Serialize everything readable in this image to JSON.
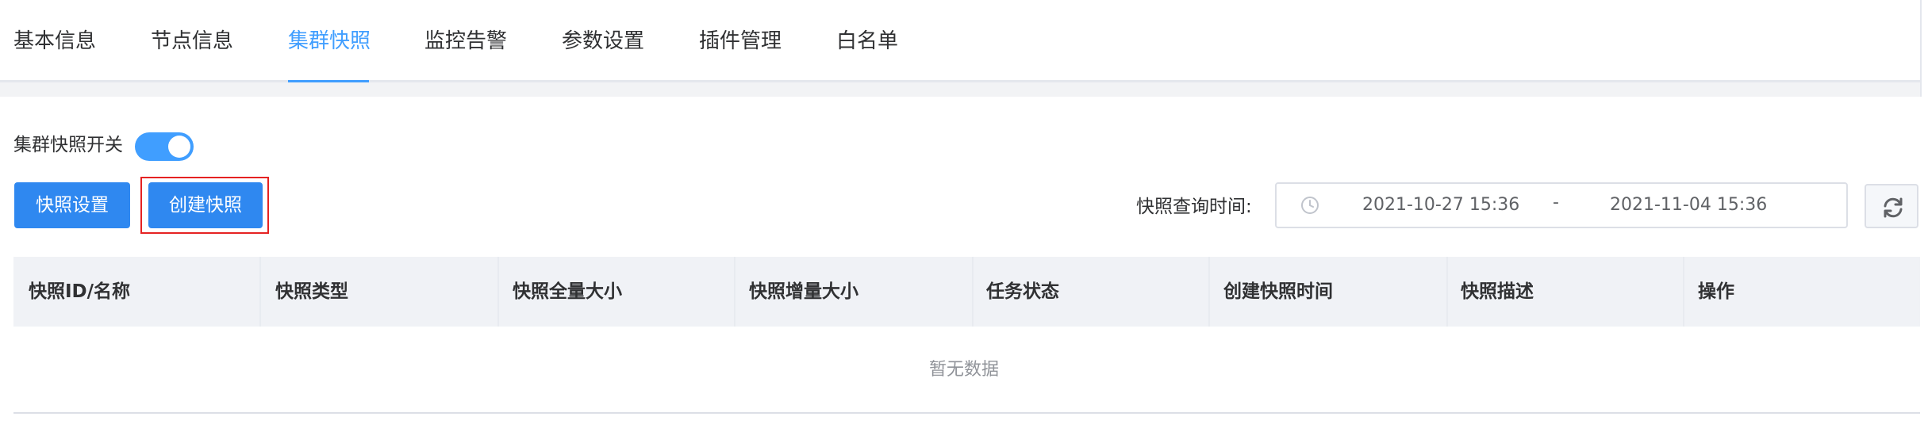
{
  "tabs": [
    {
      "label": "基本信息",
      "active": false
    },
    {
      "label": "节点信息",
      "active": false
    },
    {
      "label": "集群快照",
      "active": true
    },
    {
      "label": "监控告警",
      "active": false
    },
    {
      "label": "参数设置",
      "active": false
    },
    {
      "label": "插件管理",
      "active": false
    },
    {
      "label": "白名单",
      "active": false
    }
  ],
  "snapshot_switch": {
    "label": "集群快照开关",
    "enabled": true
  },
  "buttons": {
    "settings": "快照设置",
    "create": "创建快照"
  },
  "query": {
    "label": "快照查询时间:",
    "start": "2021-10-27 15:36",
    "separator": "-",
    "end": "2021-11-04 15:36"
  },
  "table": {
    "columns": [
      "快照ID/名称",
      "快照类型",
      "快照全量大小",
      "快照增量大小",
      "任务状态",
      "创建快照时间",
      "快照描述",
      "操作"
    ],
    "empty_text": "暂无数据"
  },
  "colors": {
    "accent": "#409eff",
    "button": "#2f88f0",
    "highlight": "#e52222"
  },
  "icons": {
    "clock": "clock-icon",
    "refresh": "refresh-icon"
  }
}
